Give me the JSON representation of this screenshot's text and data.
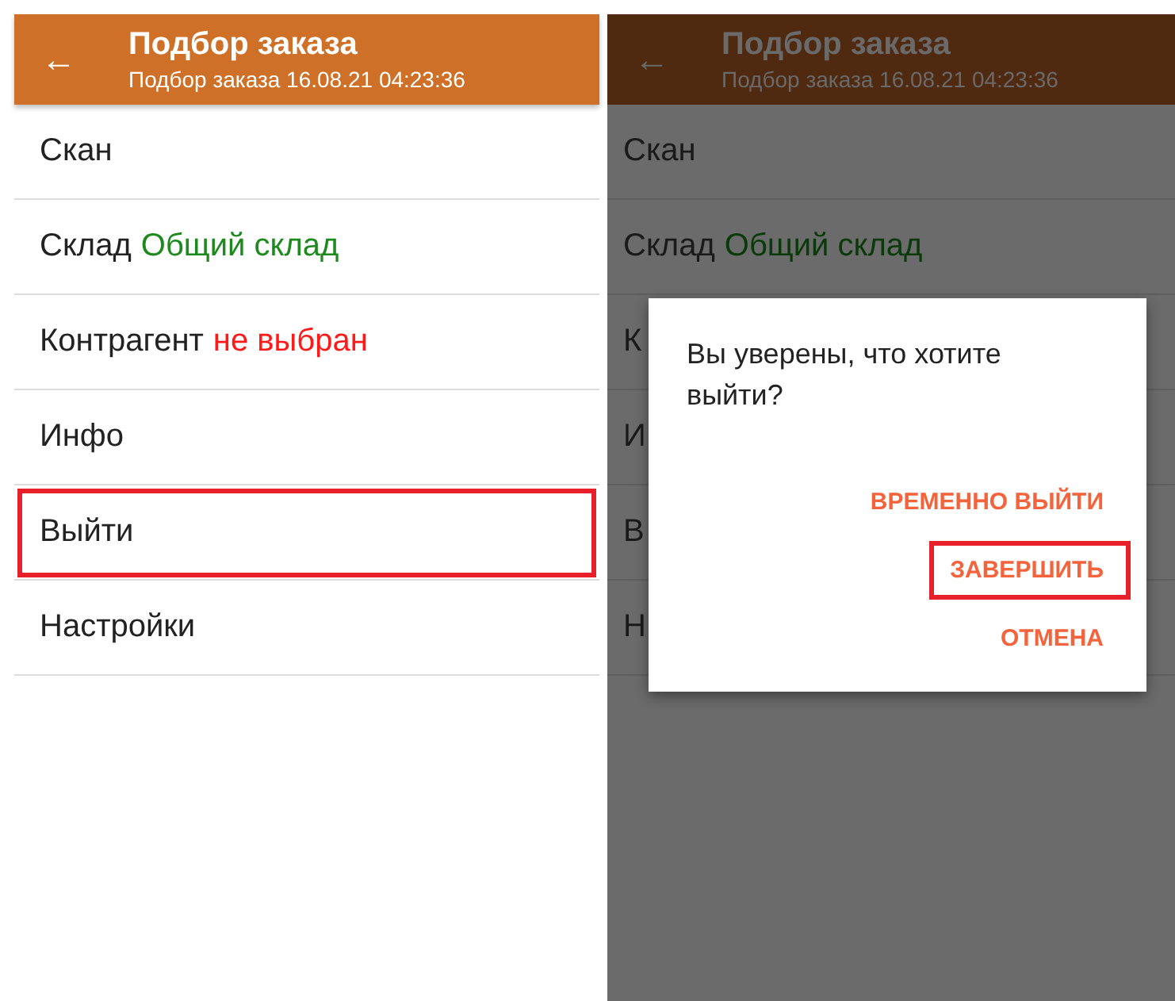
{
  "screens": [
    {
      "dimmed": false,
      "header": {
        "back": "←",
        "title": "Подбор заказа",
        "subtitle": "Подбор заказа 16.08.21 04:23:36"
      },
      "menu": [
        {
          "label": "Скан",
          "highlighted": false
        },
        {
          "label": "Склад",
          "value": "Общий склад",
          "color": "#1e8a1e",
          "highlighted": false
        },
        {
          "label": "Контрагент",
          "value": "не выбран",
          "color": "#ff1a1a",
          "highlighted": false
        },
        {
          "label": "Инфо",
          "highlighted": false
        },
        {
          "label": "Выйти",
          "highlighted": true
        },
        {
          "label": "Настройки",
          "highlighted": false
        }
      ]
    },
    {
      "dimmed": true,
      "header": {
        "back": "←",
        "title": "Подбор заказа",
        "subtitle": "Подбор заказа 16.08.21 04:23:36"
      },
      "menu": [
        {
          "label": "Скан",
          "highlighted": false
        },
        {
          "label": "Склад",
          "value": "Общий склад",
          "color": "#0a3a0a",
          "highlighted": false
        },
        {
          "label": "К",
          "highlighted": false
        },
        {
          "label": "И",
          "highlighted": false
        },
        {
          "label": "В",
          "highlighted": false
        },
        {
          "label": "Н",
          "highlighted": false
        }
      ],
      "dialog": {
        "message": "Вы уверены, что хотите выйти?",
        "buttons": [
          {
            "label": "ВРЕМЕННО ВЫЙТИ",
            "highlighted": false
          },
          {
            "label": "ЗАВЕРШИТЬ",
            "highlighted": true
          },
          {
            "label": "ОТМЕНА",
            "highlighted": false
          }
        ]
      }
    }
  ]
}
